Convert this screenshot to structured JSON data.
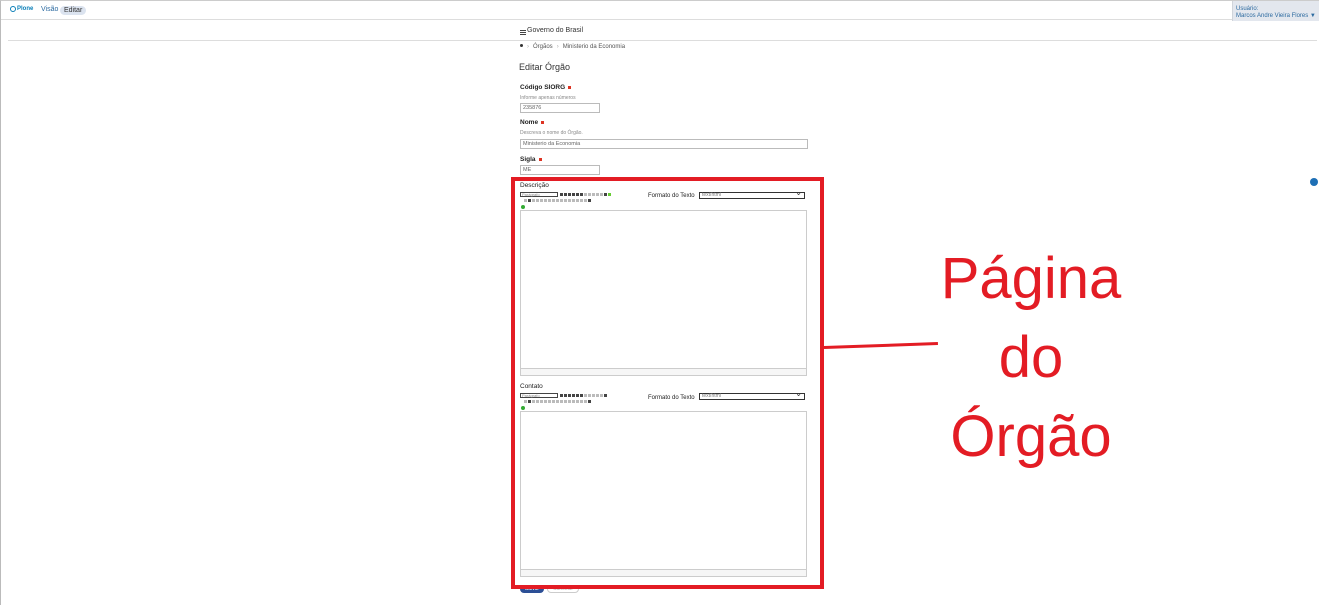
{
  "toolbar": {
    "logo_text": "Plone",
    "tabs": [
      {
        "label": "Visão"
      },
      {
        "label": "Editar"
      }
    ],
    "user_label": "Usuário:",
    "user_name": "Marcos Andre Vieira Flores ▼"
  },
  "header": {
    "site_title": "Governo do Brasil"
  },
  "breadcrumb": {
    "items": [
      "Órgãos",
      "Ministerio da Economia"
    ],
    "separator": "›"
  },
  "form": {
    "title": "Editar Órgão",
    "siorg": {
      "label": "Código SIORG",
      "help": "Informe apenas números",
      "value": "235876"
    },
    "nome": {
      "label": "Nome",
      "help": "Descreva o nome do Órgão.",
      "value": "Ministerio da Economia"
    },
    "sigla": {
      "label": "Sigla",
      "value": "ME"
    },
    "descricao": {
      "label": "Descrição",
      "paragraph_select": "Parágrafo",
      "format_label": "Formato do Texto",
      "format_value": "text/html"
    },
    "contato": {
      "label": "Contato",
      "paragraph_select": "Parágrafo",
      "format_label": "Formato do Texto",
      "format_value": "text/html"
    },
    "save_label": "Salvar",
    "cancel_label": "Cancelar"
  },
  "annotation": {
    "lines": [
      "Página",
      "do",
      "Órgão"
    ],
    "color": "#e31c24"
  }
}
